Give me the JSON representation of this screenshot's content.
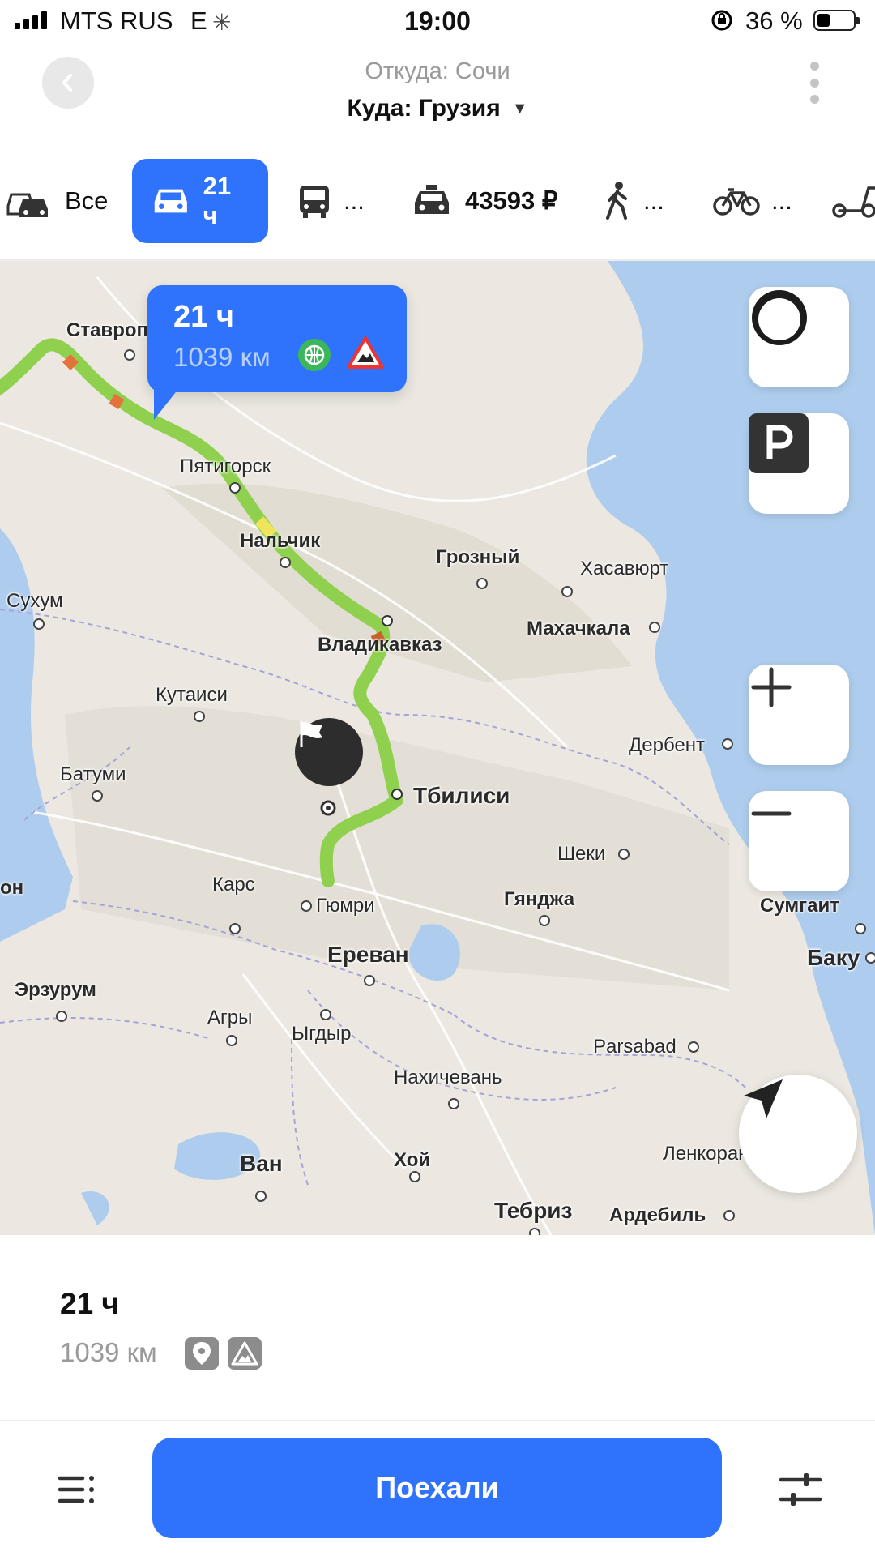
{
  "status_bar": {
    "carrier": "MTS RUS",
    "network": "E",
    "time": "19:00",
    "battery_percent": "36 %",
    "battery_level": 0.36
  },
  "header": {
    "from": "Откуда: Сочи",
    "to": "Куда: Грузия"
  },
  "tabs": [
    {
      "icon": "cars-icon",
      "label": "Все"
    },
    {
      "icon": "car-icon",
      "label": "21 ч",
      "active": true
    },
    {
      "icon": "bus-icon",
      "label": "..."
    },
    {
      "icon": "taxi-icon",
      "label": "43593 ₽"
    },
    {
      "icon": "pedestrian-icon",
      "label": "..."
    },
    {
      "icon": "bicycle-icon",
      "label": "..."
    },
    {
      "icon": "scooter-icon",
      "label": ""
    }
  ],
  "route_tooltip": {
    "time": "21 ч",
    "distance": "1039 км"
  },
  "map": {
    "cities": [
      "Ставрополь",
      "Пятигорск",
      "Нальчик",
      "Грозный",
      "Хасавюрт",
      "Сухум",
      "Владикавказ",
      "Махачкала",
      "Кутаиси",
      "Дербент",
      "Батуми",
      "Tбилиси",
      "Шеки",
      "Карс",
      "Гюмри",
      "Гянджа",
      "Сумгаит",
      "Ереван",
      "Баку",
      "Эрзурум",
      "Агры",
      "Ыгдыр",
      "Parsabad",
      "Нахичевань",
      "Ван",
      "Хой",
      "Ленкорань",
      "Тебриз",
      "Ардебиль",
      "он"
    ]
  },
  "summary": {
    "time": "21 ч",
    "distance": "1039 км"
  },
  "bottom": {
    "go_label": "Поехали"
  },
  "colors": {
    "accent": "#2f73fd",
    "route": "#8fd14f",
    "sea": "#aecdee"
  }
}
